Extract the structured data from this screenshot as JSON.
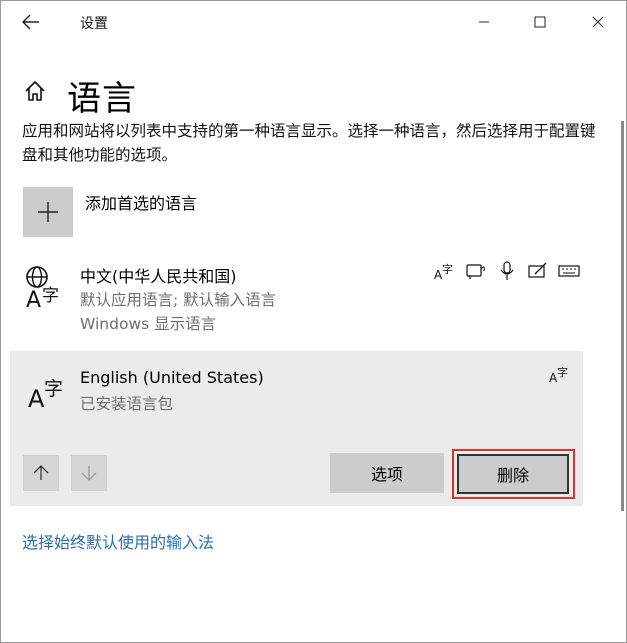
{
  "window": {
    "title": "设置"
  },
  "header": {
    "title": "语言"
  },
  "description": "应用和网站将以列表中支持的第一种语言显示。选择一种语言，然后选择用于配置键盘和其他功能的选项。",
  "add_language": {
    "label": "添加首选的语言"
  },
  "languages": [
    {
      "name": "中文(中华人民共和国)",
      "sub1": "默认应用语言; 默认输入语言",
      "sub2": "Windows 显示语言",
      "features": [
        "display-language-icon",
        "text-to-speech-icon",
        "speech-recognition-icon",
        "handwriting-icon",
        "keyboard-icon"
      ]
    },
    {
      "name": "English (United States)",
      "sub1": "已安装语言包",
      "features": [
        "display-language-icon"
      ]
    }
  ],
  "buttons": {
    "options": "选项",
    "remove": "删除"
  },
  "link": "选择始终默认使用的输入法",
  "colors": {
    "link": "#2b6db3",
    "highlight": "#d9342b",
    "panel": "#ebebeb"
  }
}
